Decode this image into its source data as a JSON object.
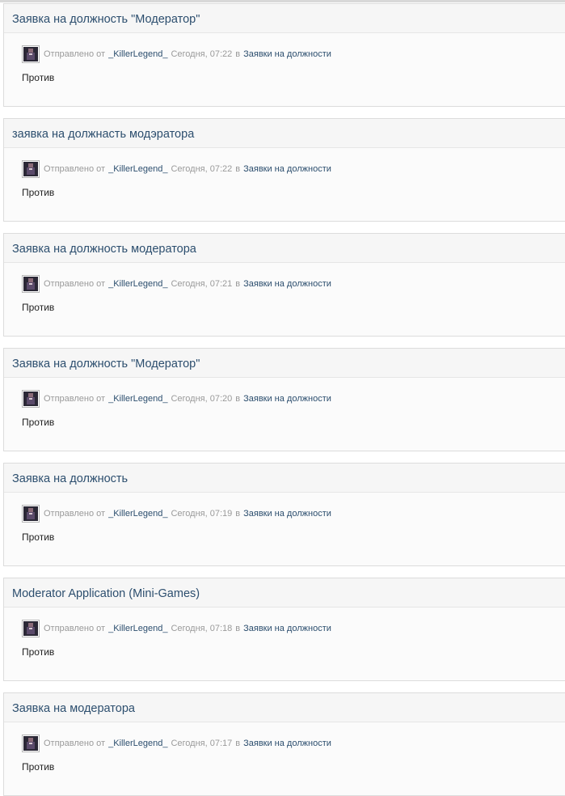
{
  "posts": [
    {
      "title": "Заявка на должность \"Модератор\"",
      "sent_label": "Отправлено от",
      "author": "_KillerLegend_",
      "time": "Сегодня, 07:22",
      "in_label": "в",
      "forum": "Заявки на должности",
      "body": "Против"
    },
    {
      "title": "заявка на должнасть модэратора",
      "sent_label": "Отправлено от",
      "author": "_KillerLegend_",
      "time": "Сегодня, 07:22",
      "in_label": "в",
      "forum": "Заявки на должности",
      "body": "Против"
    },
    {
      "title": "Заявка на должность модератора",
      "sent_label": "Отправлено от",
      "author": "_KillerLegend_",
      "time": "Сегодня, 07:21",
      "in_label": "в",
      "forum": "Заявки на должности",
      "body": "Против"
    },
    {
      "title": "Заявка на должность \"Модератор\"",
      "sent_label": "Отправлено от",
      "author": "_KillerLegend_",
      "time": "Сегодня, 07:20",
      "in_label": "в",
      "forum": "Заявки на должности",
      "body": "Против"
    },
    {
      "title": "Заявка на должность",
      "sent_label": "Отправлено от",
      "author": "_KillerLegend_",
      "time": "Сегодня, 07:19",
      "in_label": "в",
      "forum": "Заявки на должности",
      "body": "Против"
    },
    {
      "title": "Moderator Application (Mini-Games)",
      "sent_label": "Отправлено от",
      "author": "_KillerLegend_",
      "time": "Сегодня, 07:18",
      "in_label": "в",
      "forum": "Заявки на должности",
      "body": "Против"
    },
    {
      "title": "Заявка на модератора",
      "sent_label": "Отправлено от",
      "author": "_KillerLegend_",
      "time": "Сегодня, 07:17",
      "in_label": "в",
      "forum": "Заявки на должности",
      "body": "Против"
    }
  ],
  "colors": {
    "link": "#2c4e6e",
    "muted": "#9a9a9a",
    "text": "#222222",
    "panel_border": "#dcdcdc",
    "header_bg": "#f6f6f6"
  },
  "icons": {
    "avatar": "user-avatar-icon"
  }
}
